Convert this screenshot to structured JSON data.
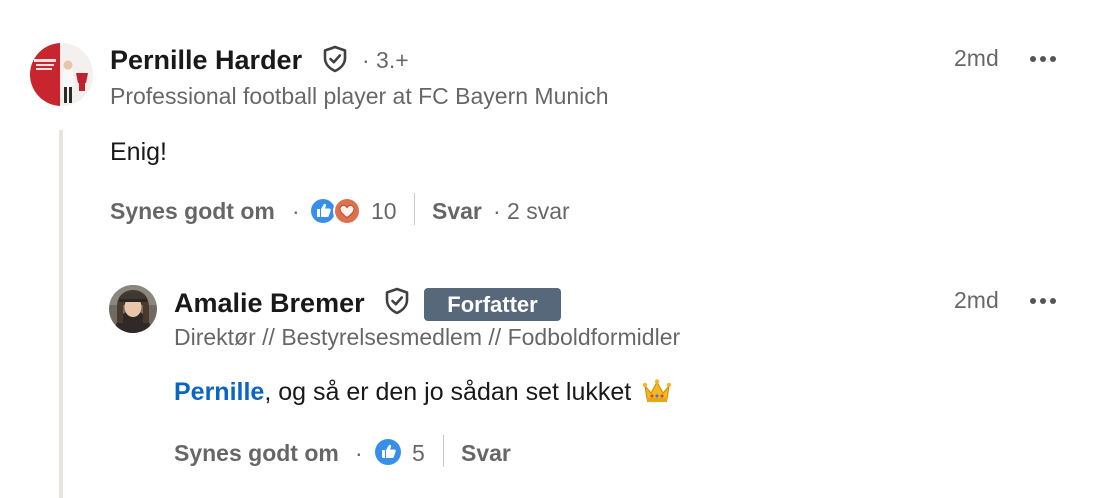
{
  "comments": [
    {
      "author": "Pernille Harder",
      "degree": "· 3.+",
      "headline": "Professional football player at FC Bayern Munich",
      "timestamp": "2md",
      "text": "Enig!",
      "like_label": "Synes godt om",
      "reactions": [
        "like-icon",
        "love-icon"
      ],
      "reaction_count": "10",
      "reply_label": "Svar",
      "reply_count": "· 2 svar"
    }
  ],
  "replies": [
    {
      "author": "Amalie Bremer",
      "badge": "Forfatter",
      "headline": "Direktør // Bestyrelsesmedlem // Fodboldformidler",
      "timestamp": "2md",
      "mention": "Pernille",
      "text": ", og så er den jo sådan set lukket",
      "emoji": "crown-emoji",
      "like_label": "Synes godt om",
      "reactions": [
        "like-icon"
      ],
      "reaction_count": "5",
      "reply_label": "Svar"
    }
  ],
  "colors": {
    "like_blue": "#378fe9",
    "love_red": "#df704d",
    "mention_blue": "#0a66c2",
    "badge_bg": "#56687a",
    "thread_line": "#e8e3de"
  }
}
